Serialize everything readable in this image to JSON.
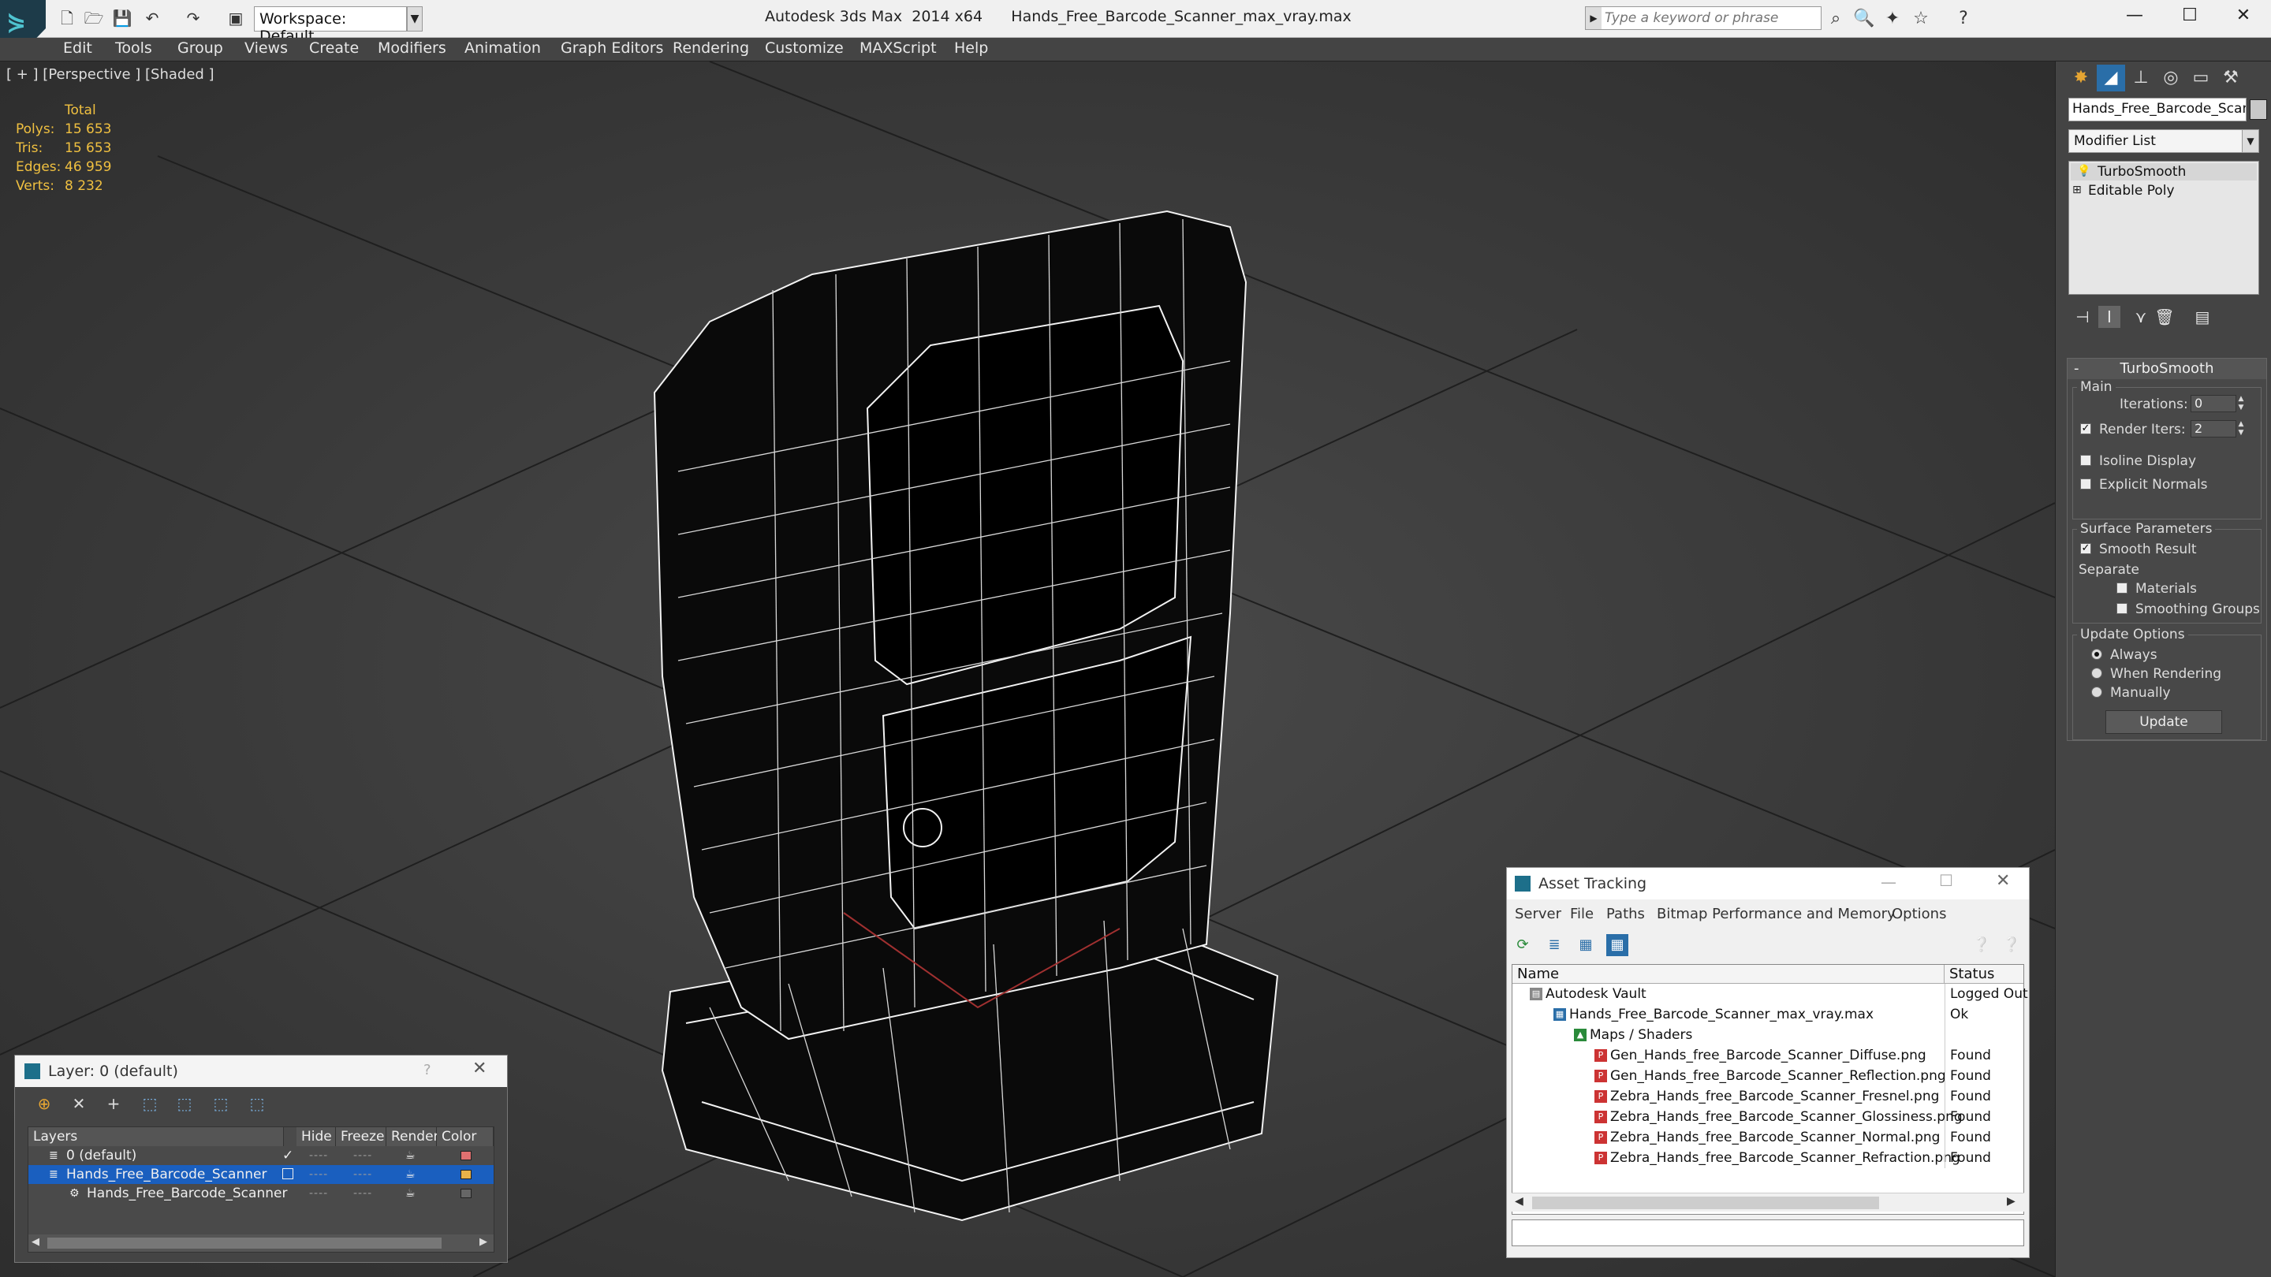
{
  "app": {
    "title": "Autodesk 3ds Max  2014 x64      Hands_Free_Barcode_Scanner_max_vray.max",
    "workspace": "Workspace: Default",
    "search_placeholder": "Type a keyword or phrase"
  },
  "menu": [
    "Edit",
    "Tools",
    "Group",
    "Views",
    "Create",
    "Modifiers",
    "Animation",
    "Graph Editors",
    "Rendering",
    "Customize",
    "MAXScript",
    "Help"
  ],
  "viewport": {
    "label": "[ + ] [Perspective ] [Shaded ]",
    "stats": {
      "header": "Total",
      "rows": [
        {
          "label": "Polys:",
          "value": "15 653"
        },
        {
          "label": "Tris:",
          "value": "15 653"
        },
        {
          "label": "Edges:",
          "value": "46 959"
        },
        {
          "label": "Verts:",
          "value": "8 232"
        }
      ]
    }
  },
  "command_panel": {
    "object_name": "Hands_Free_Barcode_Scanne",
    "modifier_list": "Modifier List",
    "stack": [
      "TurboSmooth",
      "Editable Poly"
    ],
    "rollout_title": "TurboSmooth",
    "main_label": "Main",
    "iterations_label": "Iterations:",
    "iterations_value": "0",
    "render_iters_label": "Render Iters:",
    "render_iters_value": "2",
    "isoline": "Isoline Display",
    "explicit_normals": "Explicit Normals",
    "surface_params": "Surface Parameters",
    "smooth_result": "Smooth Result",
    "separate": "Separate",
    "materials": "Materials",
    "smoothing_groups": "Smoothing Groups",
    "update_options": "Update Options",
    "always": "Always",
    "when_rendering": "When Rendering",
    "manually": "Manually",
    "update_button": "Update"
  },
  "asset_tracking": {
    "title": "Asset Tracking",
    "menu": [
      "Server",
      "File",
      "Paths",
      "Bitmap Performance and Memory",
      "Options"
    ],
    "col_name": "Name",
    "col_status": "Status",
    "rows": [
      {
        "name": "Autodesk Vault",
        "status": "Logged Out",
        "indent": 1
      },
      {
        "name": "Hands_Free_Barcode_Scanner_max_vray.max",
        "status": "Ok",
        "indent": 2
      },
      {
        "name": "Maps / Shaders",
        "status": "",
        "indent": 3
      },
      {
        "name": "Gen_Hands_free_Barcode_Scanner_Diffuse.png",
        "status": "Found",
        "indent": 4
      },
      {
        "name": "Gen_Hands_free_Barcode_Scanner_Reflection.png",
        "status": "Found",
        "indent": 4
      },
      {
        "name": "Zebra_Hands_free_Barcode_Scanner_Fresnel.png",
        "status": "Found",
        "indent": 4
      },
      {
        "name": "Zebra_Hands_free_Barcode_Scanner_Glossiness.png",
        "status": "Found",
        "indent": 4
      },
      {
        "name": "Zebra_Hands_free_Barcode_Scanner_Normal.png",
        "status": "Found",
        "indent": 4
      },
      {
        "name": "Zebra_Hands_free_Barcode_Scanner_Refraction.png",
        "status": "Found",
        "indent": 4
      }
    ]
  },
  "layer_manager": {
    "title": "Layer: 0 (default)",
    "help": "?",
    "cols": [
      "Layers",
      "Hide",
      "Freeze",
      "Render",
      "Color"
    ],
    "rows": [
      {
        "name": "0 (default)",
        "color": "#e07070"
      },
      {
        "name": "Hands_Free_Barcode_Scanner",
        "color": "#e6b24a"
      },
      {
        "name": "Hands_Free_Barcode_Scanner",
        "color": "#666666"
      }
    ]
  },
  "colors": {
    "accent": "#e6a532",
    "selection": "#1a5fbf",
    "stats": "#f0c040"
  }
}
